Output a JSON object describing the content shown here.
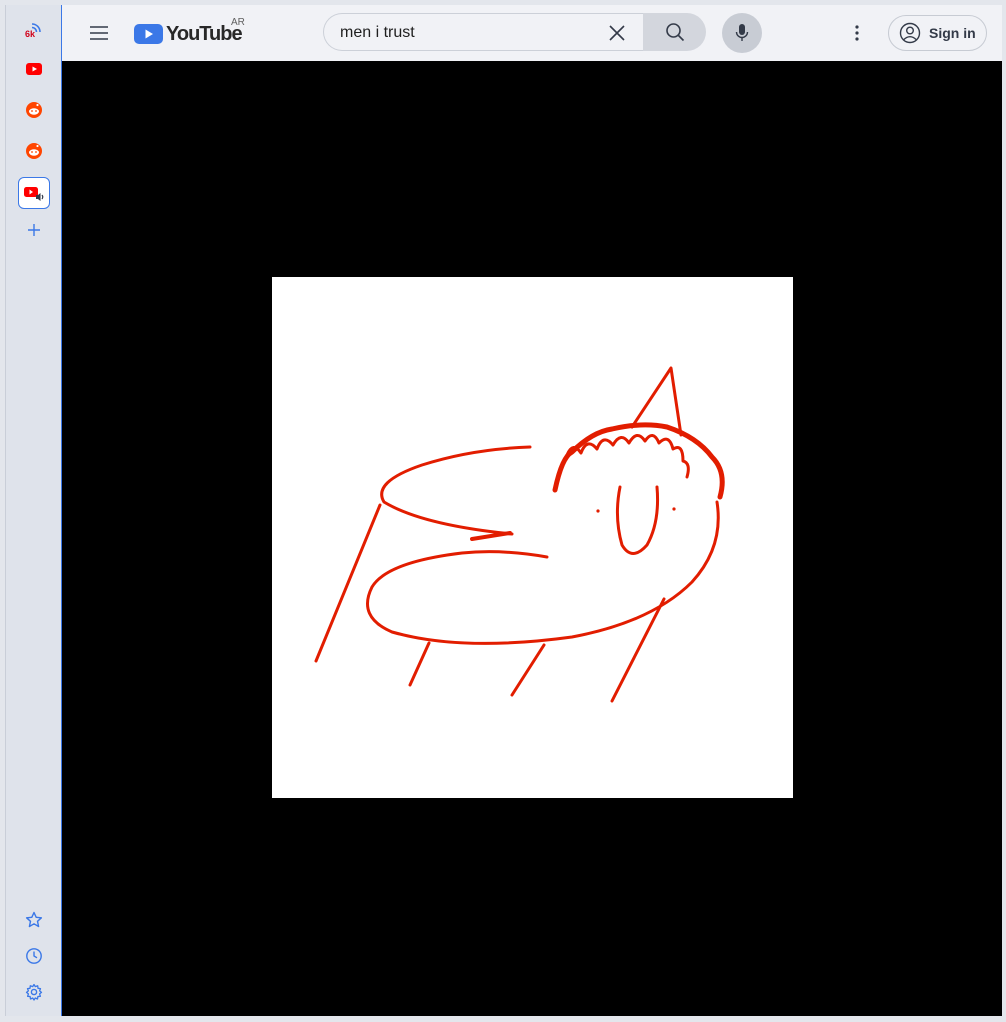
{
  "sidebar": {
    "items": [
      {
        "name": "rss-badge",
        "badge": "6k"
      },
      {
        "name": "youtube-tab"
      },
      {
        "name": "reddit-tab-1"
      },
      {
        "name": "reddit-tab-2"
      },
      {
        "name": "youtube-playing-tab"
      },
      {
        "name": "add-tab"
      }
    ],
    "bottom": [
      "bookmarks",
      "history",
      "settings"
    ]
  },
  "header": {
    "logo_text": "YouTube",
    "country_code": "AR",
    "search_value": "men i trust",
    "signin_label": "Sign in"
  },
  "colors": {
    "accent": "#3b78e7",
    "brand_red": "#ff0000",
    "drawing": "#e21d00"
  }
}
